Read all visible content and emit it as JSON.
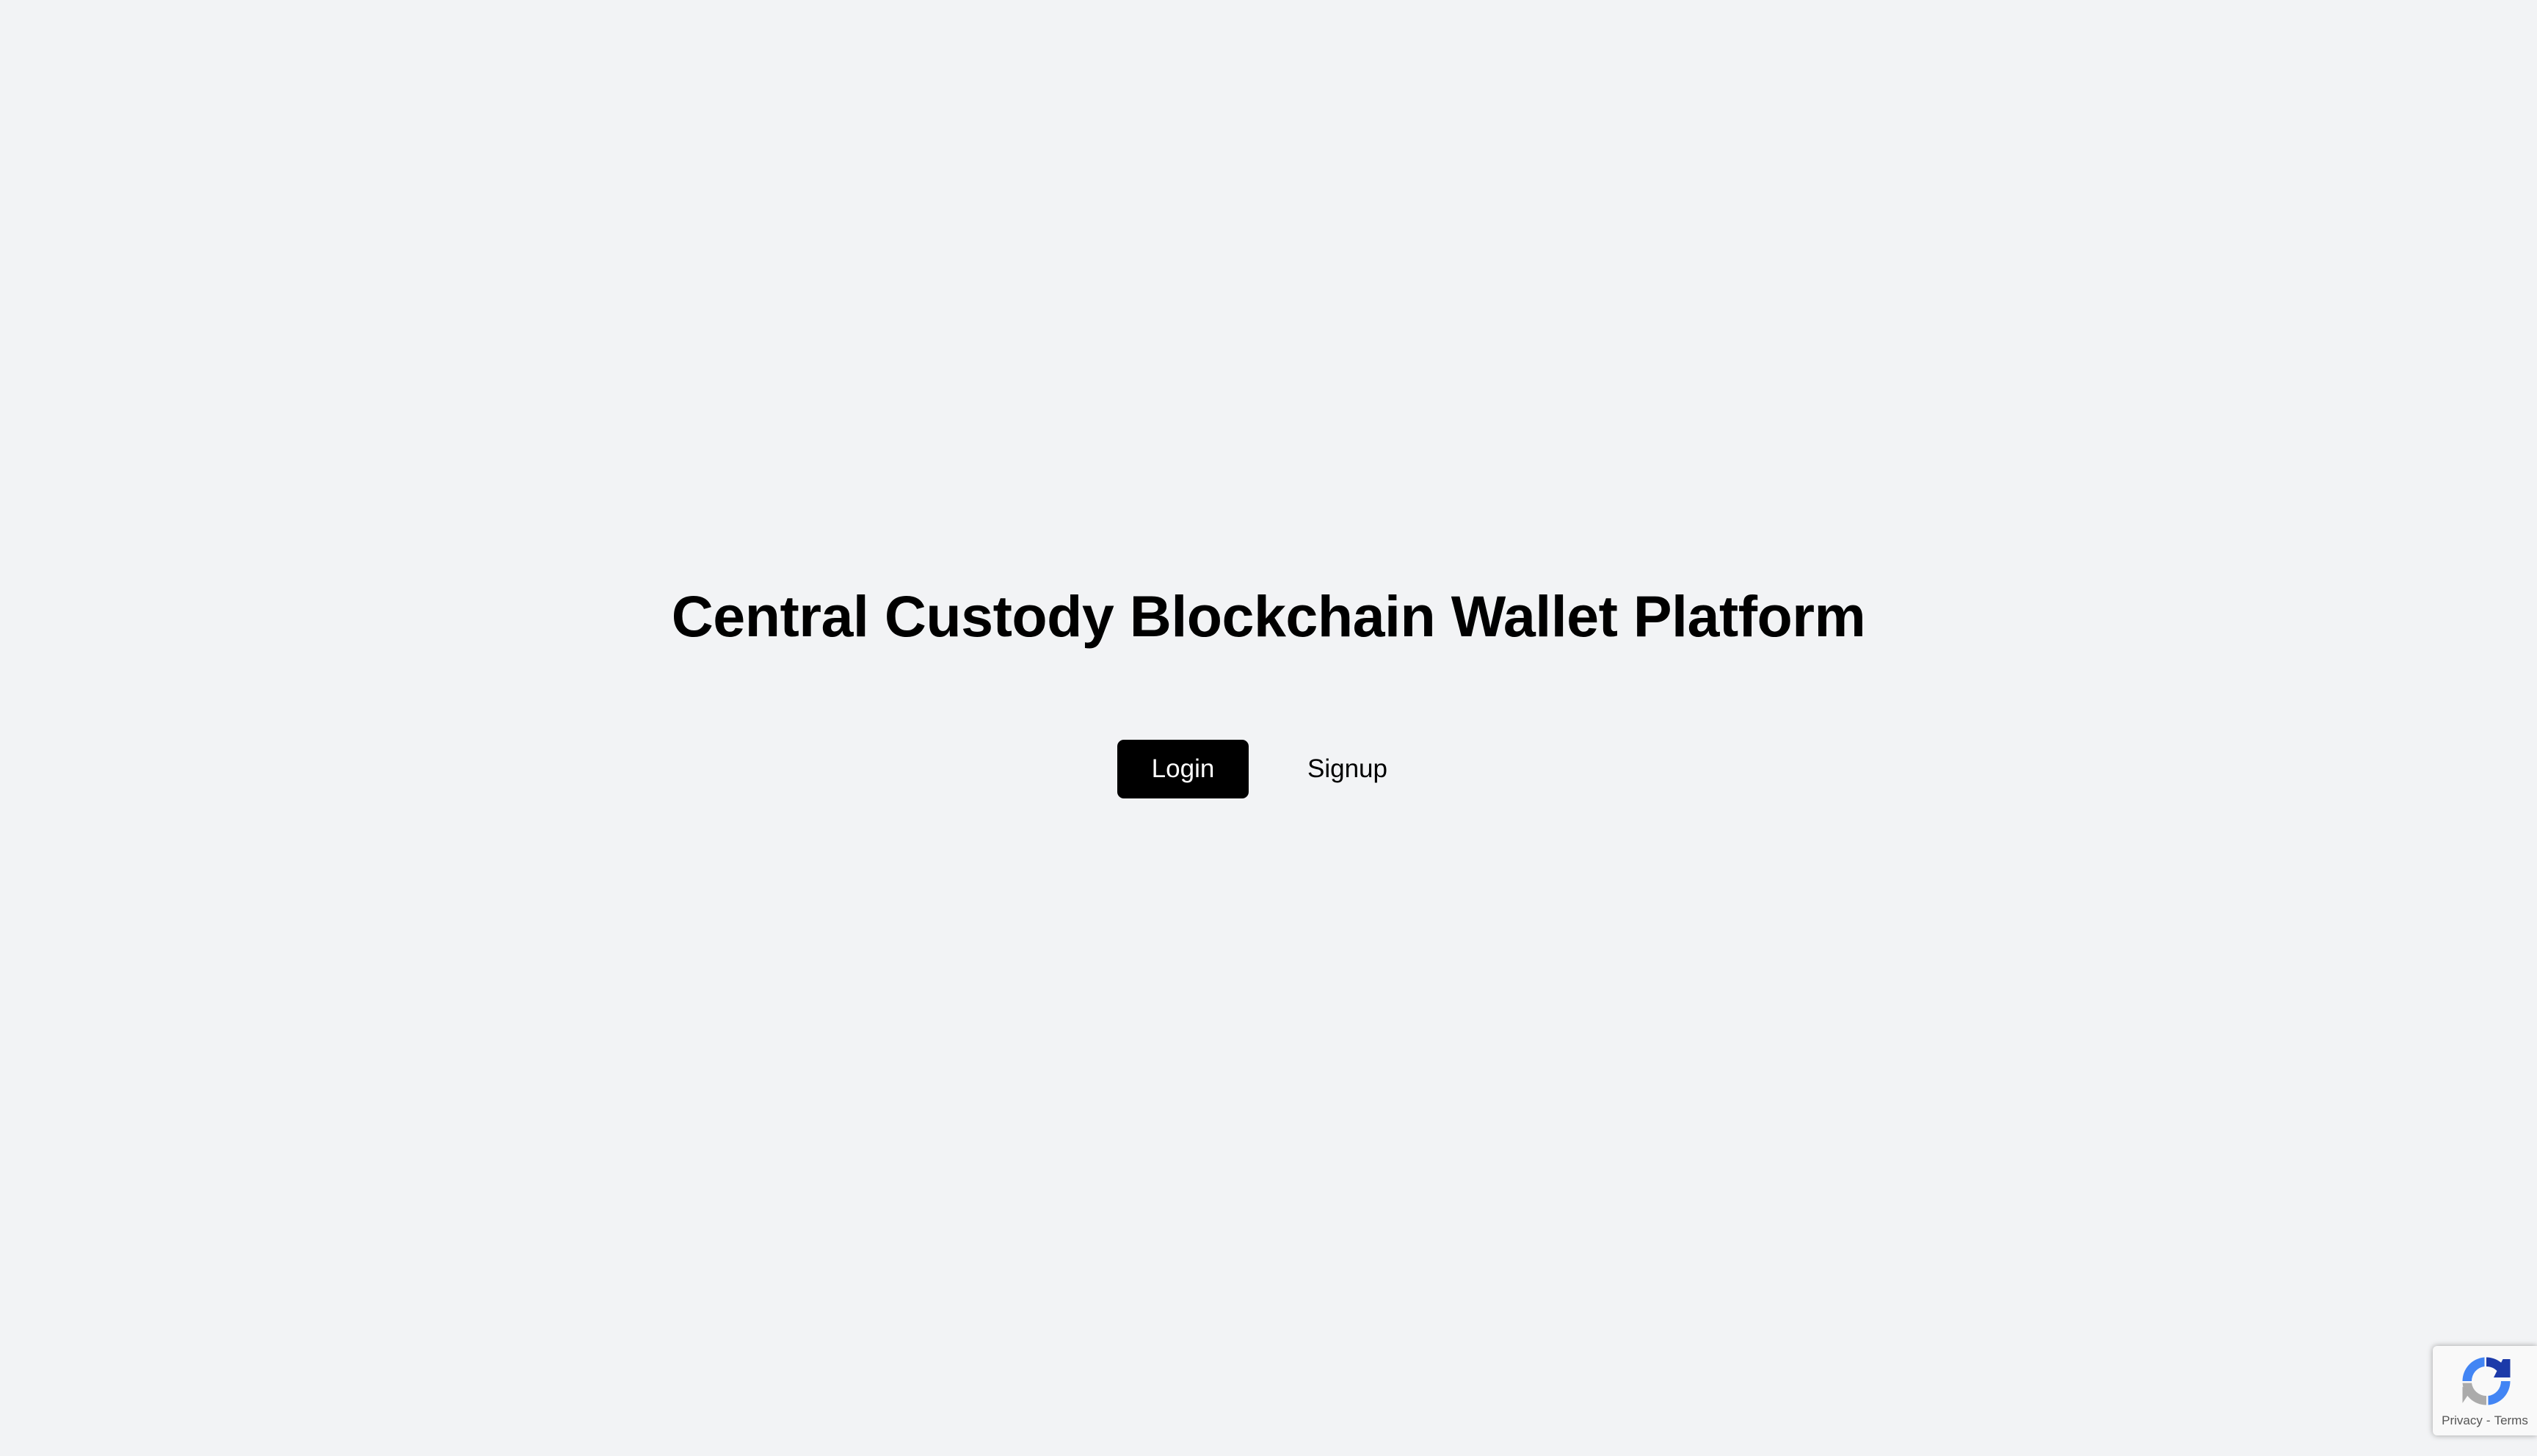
{
  "page": {
    "title": "Central Custody Blockchain Wallet Platform"
  },
  "auth": {
    "login_label": "Login",
    "signup_label": "Signup"
  },
  "recaptcha": {
    "icon": "recaptcha-icon",
    "privacy_label": "Privacy",
    "separator": "-",
    "terms_label": "Terms"
  },
  "colors": {
    "background": "#f2f3f5",
    "primary_button": "#000000",
    "primary_button_text": "#ffffff",
    "text": "#000000"
  }
}
